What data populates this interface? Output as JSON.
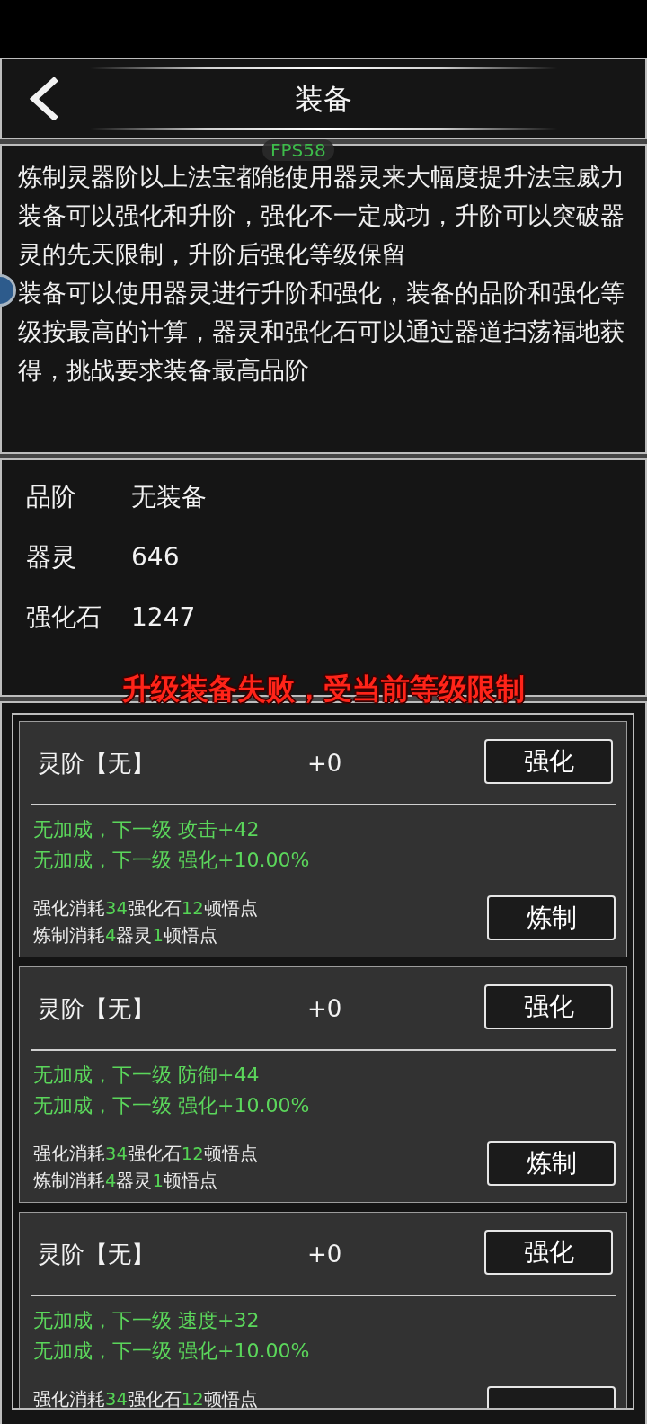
{
  "header": {
    "title": "装备"
  },
  "fps_counter": "FPS58",
  "description": {
    "paragraphs": [
      "炼制灵器阶以上法宝都能使用器灵来大幅度提升法宝威力",
      "装备可以强化和升阶，强化不一定成功，升阶可以突破器灵的先天限制，升阶后强化等级保留",
      "装备可以使用器灵进行升阶和强化，装备的品阶和强化等级按最高的计算，器灵和强化石可以通过器道扫荡福地获得，挑战要求装备最高品阶"
    ]
  },
  "stats": [
    {
      "label": "品阶",
      "value": "无装备"
    },
    {
      "label": "器灵",
      "value": "646"
    },
    {
      "label": "强化石",
      "value": "1247"
    }
  ],
  "toast": "升级装备失败，受当前等级限制",
  "cards": [
    {
      "title": "灵阶【无】",
      "level": "+0",
      "upgrade_button": "强化",
      "bonuses": [
        "无加成，下一级 攻击+42",
        "无加成，下一级 强化+10.00%"
      ],
      "costs": [
        [
          {
            "text": "强化消耗",
            "highlight": false
          },
          {
            "text": "34",
            "highlight": true
          },
          {
            "text": "强化石",
            "highlight": false
          },
          {
            "text": "12",
            "highlight": true
          },
          {
            "text": "顿悟点",
            "highlight": false
          }
        ],
        [
          {
            "text": "炼制消耗",
            "highlight": false
          },
          {
            "text": "4",
            "highlight": true
          },
          {
            "text": "器灵",
            "highlight": false
          },
          {
            "text": "1",
            "highlight": true
          },
          {
            "text": "顿悟点",
            "highlight": false
          }
        ]
      ],
      "refine_button": "炼制"
    },
    {
      "title": "灵阶【无】",
      "level": "+0",
      "upgrade_button": "强化",
      "bonuses": [
        "无加成，下一级 防御+44",
        "无加成，下一级 强化+10.00%"
      ],
      "costs": [
        [
          {
            "text": "强化消耗",
            "highlight": false
          },
          {
            "text": "34",
            "highlight": true
          },
          {
            "text": "强化石",
            "highlight": false
          },
          {
            "text": "12",
            "highlight": true
          },
          {
            "text": "顿悟点",
            "highlight": false
          }
        ],
        [
          {
            "text": "炼制消耗",
            "highlight": false
          },
          {
            "text": "4",
            "highlight": true
          },
          {
            "text": "器灵",
            "highlight": false
          },
          {
            "text": "1",
            "highlight": true
          },
          {
            "text": "顿悟点",
            "highlight": false
          }
        ]
      ],
      "refine_button": "炼制"
    },
    {
      "title": "灵阶【无】",
      "level": "+0",
      "upgrade_button": "强化",
      "bonuses": [
        "无加成，下一级 速度+32",
        "无加成，下一级 强化+10.00%"
      ],
      "costs": [
        [
          {
            "text": "强化消耗",
            "highlight": false
          },
          {
            "text": "34",
            "highlight": true
          },
          {
            "text": "强化石",
            "highlight": false
          },
          {
            "text": "12",
            "highlight": true
          },
          {
            "text": "顿悟点",
            "highlight": false
          }
        ]
      ]
    }
  ]
}
